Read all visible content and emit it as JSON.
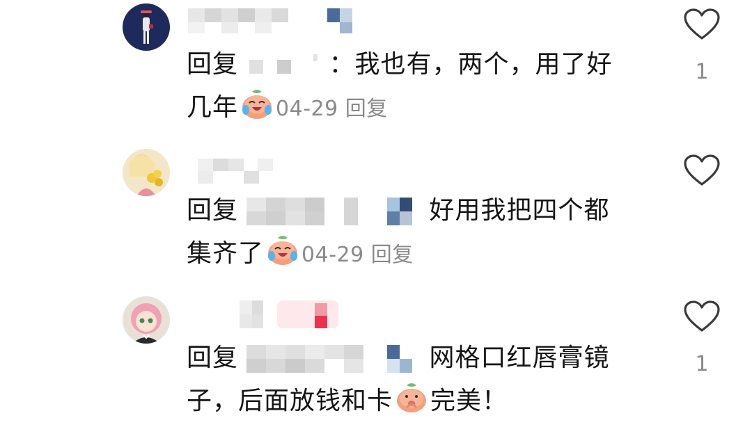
{
  "comments": [
    {
      "reply_prefix": "回复",
      "colon": "：",
      "text_line1": "我也有，两个，用了好",
      "text_line2": "几年",
      "date": "04-29",
      "reply_label": "回复",
      "like_count": "1",
      "avatar_icon": "girl-walking-avatar",
      "emoji": "crying-laughing-peach-emoji"
    },
    {
      "reply_prefix": "回复",
      "text_line1": "好用我把四个都",
      "text_line2": "集齐了",
      "date": "04-29",
      "reply_label": "回复",
      "like_count": "",
      "avatar_icon": "girl-with-flowers-avatar",
      "emoji": "crying-laughing-peach-emoji"
    },
    {
      "reply_prefix": "回复",
      "text_line1": "网格口红唇膏镜",
      "text_line2": "子，后面放钱和卡",
      "text_line2_end": "完美！",
      "like_count": "1",
      "avatar_icon": "anime-girl-avatar",
      "emoji": "shy-peach-emoji"
    }
  ],
  "colors": {
    "text": "#161616",
    "meta": "#8a8a8a",
    "heart_outline": "#3a3a3a"
  }
}
